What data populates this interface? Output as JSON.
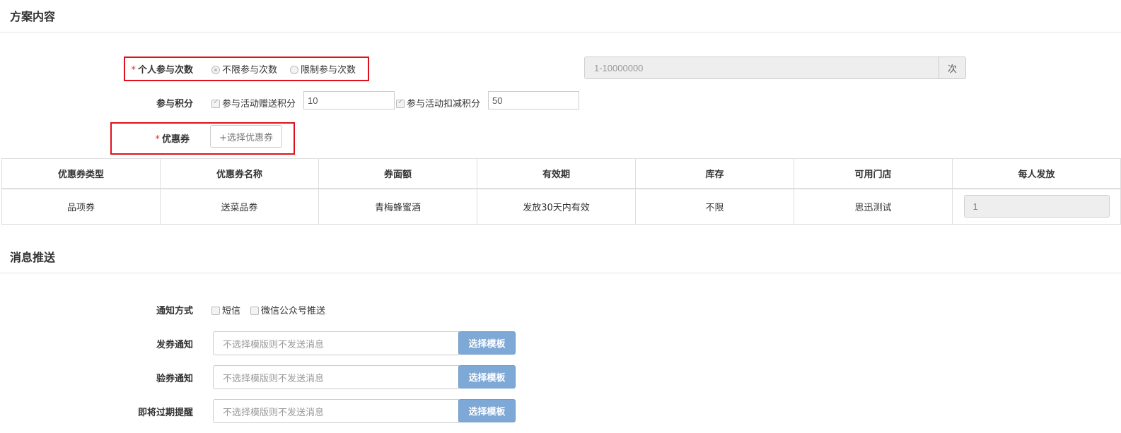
{
  "plan": {
    "title": "方案内容",
    "participation": {
      "label": "个人参与次数",
      "required_mark": "*",
      "option_unlimited": "不限参与次数",
      "option_limited": "限制参与次数",
      "range_placeholder": "1-10000000",
      "unit": "次"
    },
    "points": {
      "label": "参与积分",
      "gift_label": "参与活动赠送积分",
      "gift_value": "10",
      "deduct_label": "参与活动扣减积分",
      "deduct_value": "50"
    },
    "coupon": {
      "label": "优惠券",
      "required_mark": "*",
      "select_button": "+选择优惠券"
    },
    "table": {
      "headers": [
        "优惠券类型",
        "优惠券名称",
        "券面额",
        "有效期",
        "库存",
        "可用门店",
        "每人发放"
      ],
      "rows": [
        {
          "type": "品项券",
          "name": "送菜品券",
          "face_value": "青梅蜂蜜酒",
          "validity": "发放30天内有效",
          "stock": "不限",
          "store": "思迅测试",
          "per_person": "1"
        }
      ]
    }
  },
  "message": {
    "title": "消息推送",
    "notify_method": {
      "label": "通知方式",
      "sms": "短信",
      "wechat": "微信公众号推送"
    },
    "issue_notice": {
      "label": "发券通知",
      "placeholder": "不选择模版则不发送消息",
      "button": "选择模板"
    },
    "verify_notice": {
      "label": "验券通知",
      "placeholder": "不选择模版则不发送消息",
      "button": "选择模板"
    },
    "expire_notice": {
      "label": "即将过期提醒",
      "placeholder": "不选择模版则不发送消息",
      "button": "选择模板"
    }
  },
  "colors": {
    "required": "#d9302b",
    "highlight_box": "#e0111c",
    "primary_button": "#7ea8d6"
  }
}
